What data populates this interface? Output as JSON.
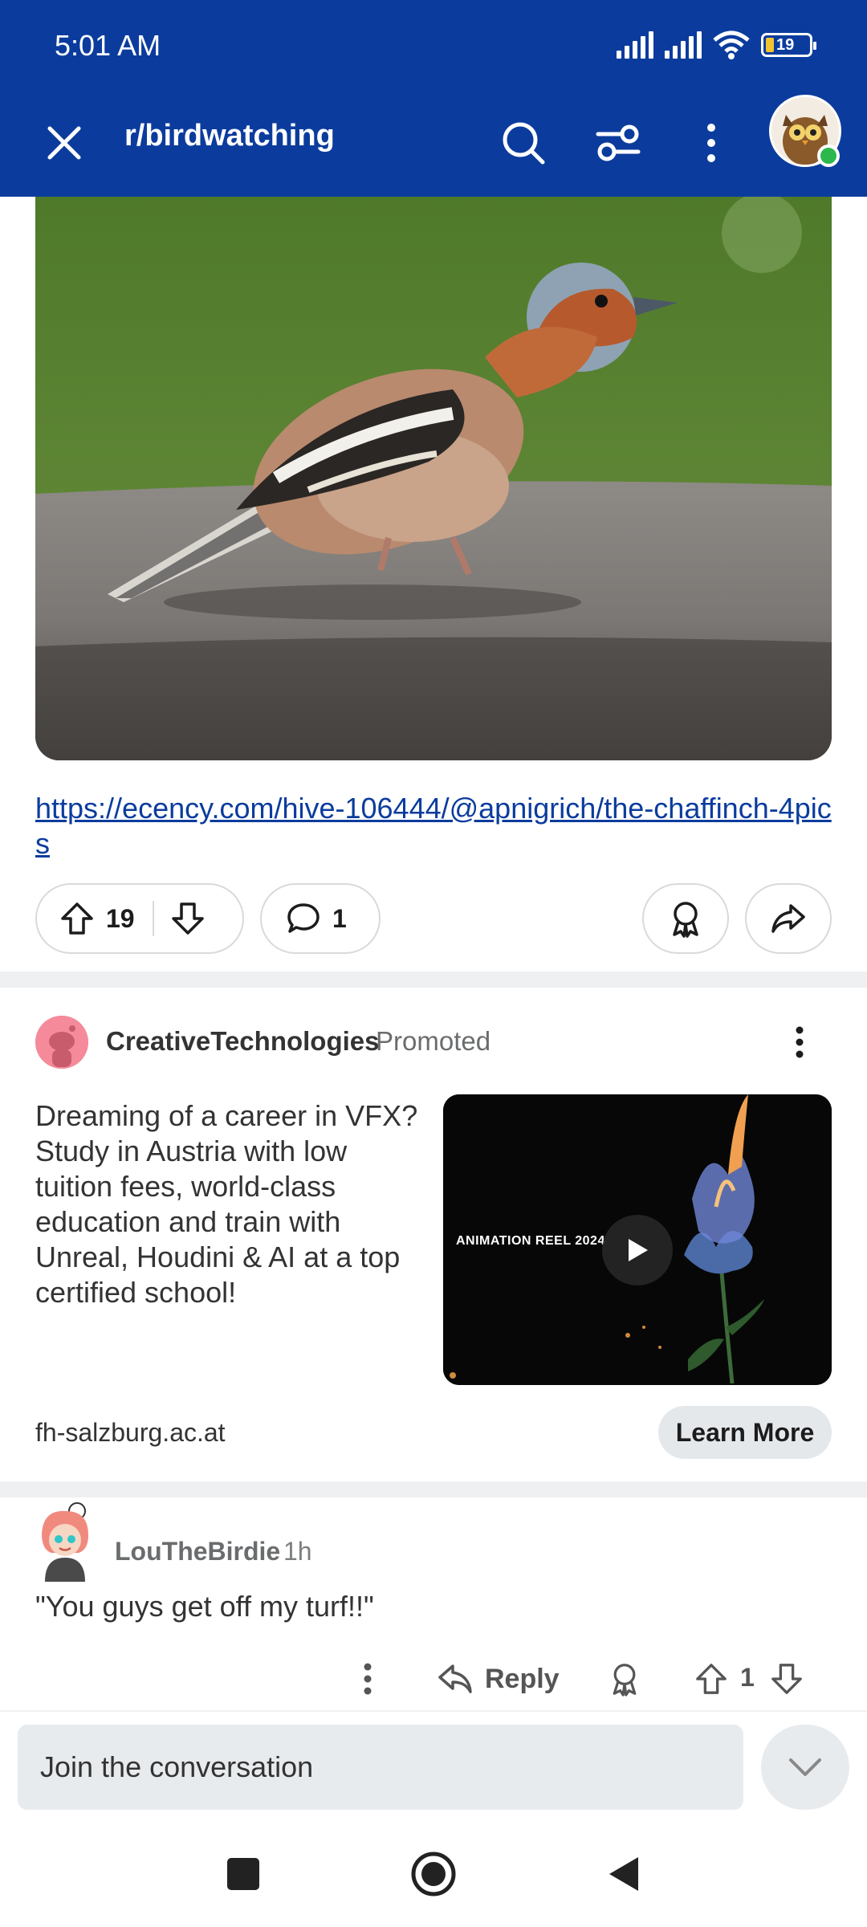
{
  "status_bar": {
    "time": "5:01 AM",
    "battery": "19"
  },
  "toolbar": {
    "title": "r/birdwatching"
  },
  "post": {
    "link": "https://ecency.com/hive-106444/@apnigrich/the-chaffinch-4pics",
    "votes": "19",
    "comments": "1"
  },
  "promoted": {
    "author": "CreativeTechnologies",
    "tag": "Promoted",
    "text": "Dreaming of a career in VFX? Study in Austria with low tuition fees, world-class education and train with Unreal, Houdini & AI at a top certified school!",
    "video_label": "ANIMATION REEL 2024",
    "domain": "fh-salzburg.ac.at",
    "cta": "Learn More"
  },
  "comment": {
    "user": "LouTheBirdie",
    "time": "1h",
    "body": "\"You guys get off my turf!!\"",
    "reply_label": "Reply",
    "votes": "1"
  },
  "compose": {
    "placeholder": "Join the conversation"
  },
  "colors": {
    "header": "#0b3c9d",
    "link": "#0b3c9d",
    "online": "#2db84d"
  }
}
